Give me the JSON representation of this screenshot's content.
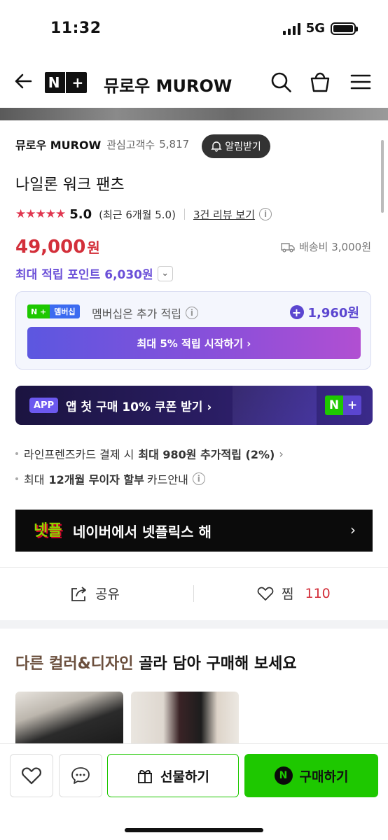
{
  "status": {
    "time": "11:32",
    "network": "5G"
  },
  "nav": {
    "store_title": "뮤로우 MUROW",
    "logo": "N+"
  },
  "store": {
    "name": "뮤로우 MUROW",
    "followers_label": "관심고객수",
    "followers_count": "5,817",
    "alert_label": "알림받기"
  },
  "product": {
    "name": "나일론 워크 팬츠",
    "stars": "★★★★★",
    "rating": "5.0",
    "rating_recent": "(최근 6개월 5.0)",
    "review_link": "3건 리뷰 보기",
    "price": "49,000",
    "price_unit": "원",
    "shipping": "배송비 3,000원",
    "points": "최대 적립 포인트 6,030원"
  },
  "membership": {
    "badge_left": "N +",
    "badge_right": "멤버십",
    "text": "멤버십은 추가 적립",
    "bonus": "1,960원",
    "cta": "최대 5% 적립 시작하기 ›"
  },
  "app_banner": {
    "chip": "APP",
    "text": "앱 첫 구매 10% 쿠폰 받기 ›",
    "logo_n": "N",
    "logo_plus": "+"
  },
  "benefits": [
    {
      "prefix": "라인프렌즈카드 결제 시",
      "bold": "최대 980원 추가적립 (2%)",
      "suffix": "›"
    },
    {
      "prefix": "최대",
      "bold": "12개월 무이자 할부",
      "suffix": "카드안내"
    }
  ],
  "netflix_banner": {
    "logo": "넷플",
    "text": "네이버에서 넷플릭스 해",
    "chevron": "›"
  },
  "actions": {
    "share": "공유",
    "zzim": "찜",
    "zzim_count": "110"
  },
  "section": {
    "title_colored": "다른 컬러&디자인",
    "title_rest": " 골라 담아 구매해 보세요"
  },
  "bottom_bar": {
    "gift": "선물하기",
    "buy": "구매하기",
    "buy_icon": "N"
  },
  "colors": {
    "price_red": "#d32f3a",
    "naver_green": "#1ec800",
    "purple": "#6b4fd8"
  }
}
